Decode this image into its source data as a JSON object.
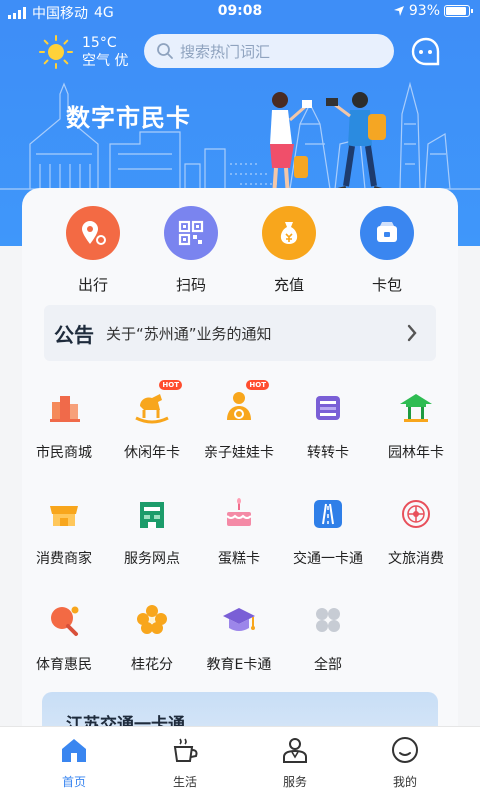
{
  "status_bar": {
    "carrier": "中国移动",
    "network": "4G",
    "time": "09:08",
    "battery": "93%",
    "battery_level": 0.93
  },
  "header": {
    "temperature": "15°C",
    "air_quality": "空气 优",
    "search_placeholder": "搜索热门词汇"
  },
  "banner": {
    "title": "数字市民卡"
  },
  "quick_actions": [
    {
      "label": "出行",
      "icon": "location-pin-icon",
      "color": "#f36a44"
    },
    {
      "label": "扫码",
      "icon": "qr-code-icon",
      "color": "#7a84ef"
    },
    {
      "label": "充值",
      "icon": "money-bag-icon",
      "color": "#f8a61c"
    },
    {
      "label": "卡包",
      "icon": "card-wallet-icon",
      "color": "#3a86f0"
    }
  ],
  "notice": {
    "tag": "公告",
    "message": "关于“苏州通”业务的通知"
  },
  "services": [
    {
      "label": "市民商城",
      "icon": "mall-building-icon"
    },
    {
      "label": "休闲年卡",
      "icon": "rocking-horse-icon",
      "badge": "HOT"
    },
    {
      "label": "亲子娃娃卡",
      "icon": "parent-child-icon",
      "badge": "HOT"
    },
    {
      "label": "转转卡",
      "icon": "transfer-card-icon"
    },
    {
      "label": "园林年卡",
      "icon": "pavilion-icon"
    },
    {
      "label": "消费商家",
      "icon": "storefront-icon"
    },
    {
      "label": "服务网点",
      "icon": "service-outlet-icon"
    },
    {
      "label": "蛋糕卡",
      "icon": "cake-icon"
    },
    {
      "label": "交通一卡通",
      "icon": "road-icon"
    },
    {
      "label": "文旅消费",
      "icon": "culture-tourism-icon"
    },
    {
      "label": "体育惠民",
      "icon": "ping-pong-icon"
    },
    {
      "label": "桂花分",
      "icon": "osmanthus-flower-icon"
    },
    {
      "label": "教育E卡通",
      "icon": "graduation-cap-icon"
    },
    {
      "label": "全部",
      "icon": "all-grid-icon"
    }
  ],
  "promo_card": {
    "title": "江苏交通一卡通"
  },
  "tabs": [
    {
      "label": "首页",
      "icon": "home-icon",
      "active": true
    },
    {
      "label": "生活",
      "icon": "coffee-cup-icon"
    },
    {
      "label": "服务",
      "icon": "service-person-icon"
    },
    {
      "label": "我的",
      "icon": "profile-face-icon"
    }
  ],
  "colors": {
    "primary": "#3e8ef7",
    "hot_badge": "#ff4d2e"
  }
}
